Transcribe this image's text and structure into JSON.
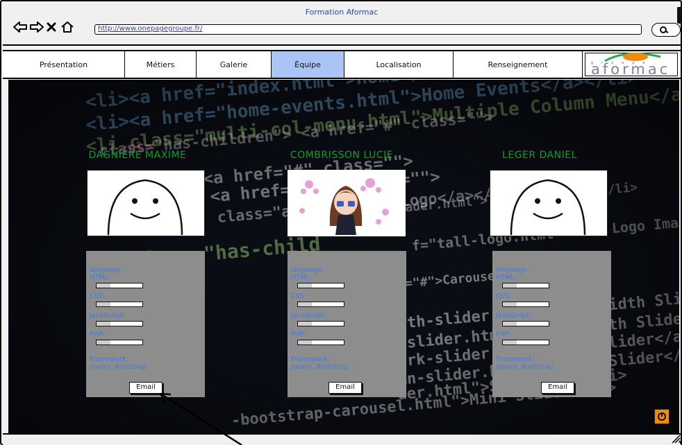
{
  "window": {
    "title": "Formation Aformac",
    "url": "http://www.onepagegroupe.fr/"
  },
  "nav": {
    "items": [
      {
        "label": "Présentation"
      },
      {
        "label": "Métiers"
      },
      {
        "label": "Galerie"
      },
      {
        "label": "Équipe",
        "active": true
      },
      {
        "label": "Localisation"
      },
      {
        "label": "Renseignement"
      }
    ],
    "logo_text": "aformac",
    "logo_group": "groupe"
  },
  "team": [
    {
      "name": "DAGNIERE MAXIME",
      "photo": "smiley-placeholder-icon",
      "skills_heading": "language:",
      "skills": [
        {
          "label": "HTML:",
          "level": 0.3
        },
        {
          "label": "CSS:",
          "level": 0.3
        },
        {
          "label": "JavaScript:",
          "level": 0.3
        },
        {
          "label": "PHP:",
          "level": 0.3
        }
      ],
      "framework_heading": "Framework:",
      "frameworks": "Jquery, Bootstrap",
      "email_label": "Email"
    },
    {
      "name": "COMBRISSON LUCIE",
      "photo": "anime-girl-avatar-icon",
      "skills_heading": "language:",
      "skills": [
        {
          "label": "HTML:",
          "level": 0.3
        },
        {
          "label": "CSS:",
          "level": 0.3
        },
        {
          "label": "JavaScript:",
          "level": 0.3
        },
        {
          "label": "PHP:",
          "level": 0.3
        }
      ],
      "framework_heading": "Framework:",
      "frameworks": "Jquery, Bootstrap",
      "email_label": "Email"
    },
    {
      "name": "LEGER DANIEL",
      "photo": "smiley-placeholder-icon",
      "skills_heading": "language:",
      "skills": [
        {
          "label": "HTML:",
          "level": 0.3
        },
        {
          "label": "CSS:",
          "level": 0.3
        },
        {
          "label": "JavaScript:",
          "level": 0.3
        },
        {
          "label": "PHP:",
          "level": 0.3
        }
      ],
      "framework_heading": "Framework:",
      "frameworks": "Jquery, Bootstrap",
      "email_label": "Email"
    }
  ],
  "background_code": [
    "<li><a href=\"index.html\">Home</a></li>",
    "<li><a href=\"home-events.html\">Home Events</a></li>",
    "<li class=\"multi-col-menu.html\">Multiple Column Menu</a></li>",
    "class=\"has-children\"> <a href=\"#\" class=\"\">",
    "<ul>",
    "<a href=\"#\" class=\"\">",
    "<a href=\"...\" class=\"\">",
    "eader.html\">Tall Header</a></li>",
    "class=\"ac   ml\">Image Logo</a></li>",
    "f=\"tall-logo.html\">Tall Logo Image</a></li>",
    "class=\"has-child",
    "f=\"#\">Carousels</a>",
    "dth-slider.html\">Full Width Slider</a>",
    "-slider.html\">Image Width Slider</a>",
    "ork-slider.html\">Work Slider</a>",
    "mn-slider.html\">Column Slider</a>",
    "der.html\">Slider</a></li>",
    "-bootstrap-carousel.html\">Mini Slider</li>"
  ],
  "colors": {
    "accent_active_tab": "#a9c4f5",
    "name_green": "#0d9d2f",
    "card_gray": "#8d8d8d",
    "card_text_blue": "#3a7bea",
    "scroll_button_orange": "#f08a0f"
  }
}
